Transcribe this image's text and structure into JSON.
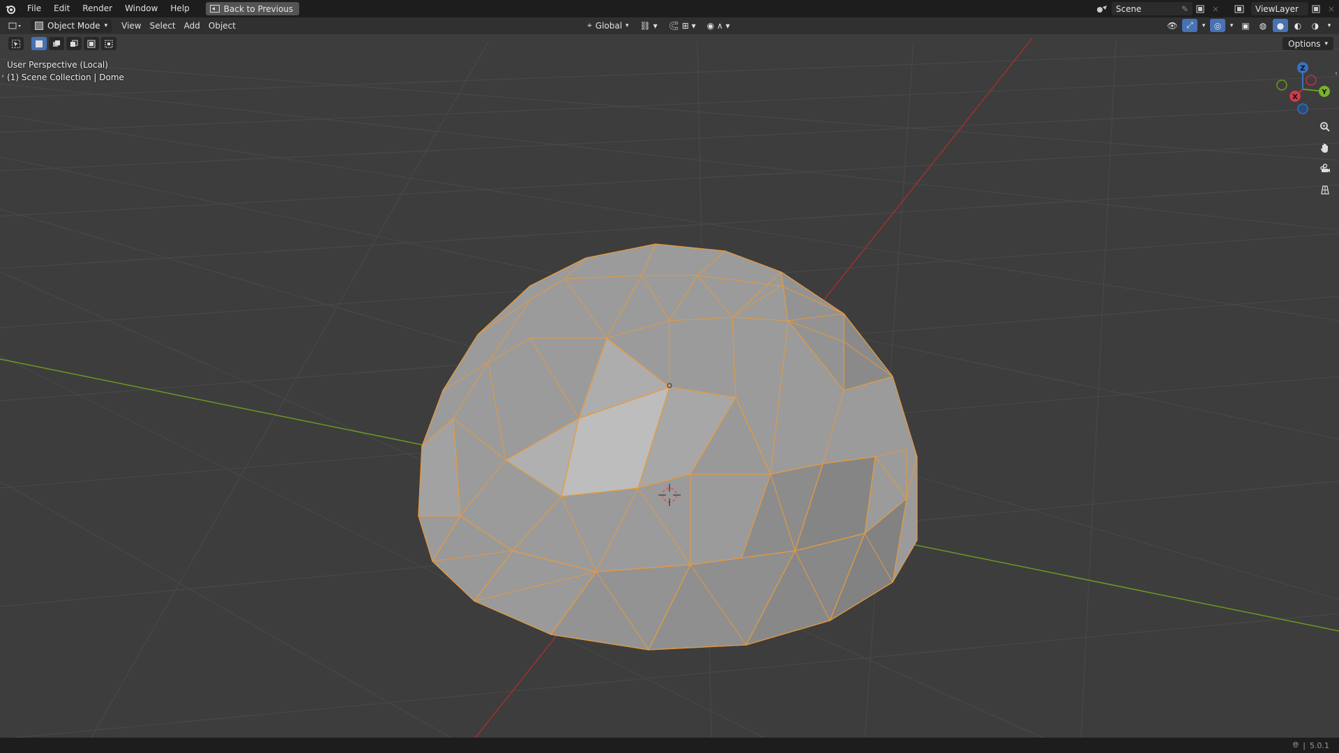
{
  "topbar": {
    "menu": [
      "File",
      "Edit",
      "Render",
      "Window",
      "Help"
    ],
    "back_button": "Back to Previous",
    "scene_name": "Scene",
    "view_layer": "ViewLayer"
  },
  "header": {
    "mode": "Object Mode",
    "menus": [
      "View",
      "Select",
      "Add",
      "Object"
    ],
    "transform_orientation": "Global",
    "options": "Options"
  },
  "viewport": {
    "perspective": "User Perspective (Local)",
    "collection": "(1) Scene Collection | Dome",
    "gizmo_axes": {
      "x": "X",
      "y": "Y",
      "z": "Z"
    }
  },
  "statusbar": {
    "version": "5.0.1"
  },
  "colors": {
    "background": "#3d3d3d",
    "selection_outline": "#f0a040",
    "x_axis": "#a03030",
    "y_axis": "#6a9a20",
    "active_button": "#4772b3"
  },
  "icons": [
    "blender-logo-icon",
    "back-icon",
    "scene-icon",
    "pin-icon",
    "view-layer-icon",
    "editor-type-icon",
    "object-mode-icon",
    "orientation-icon",
    "pivot-icon",
    "snap-icon",
    "proportional-icon",
    "visibility-icon",
    "gizmo-icon",
    "overlay-icon",
    "xray-icon",
    "wireframe-icon",
    "solid-icon",
    "material-icon",
    "rendered-icon",
    "select-tool-icon",
    "zoom-icon",
    "hand-icon",
    "camera-icon",
    "grid-icon",
    "network-icon"
  ]
}
